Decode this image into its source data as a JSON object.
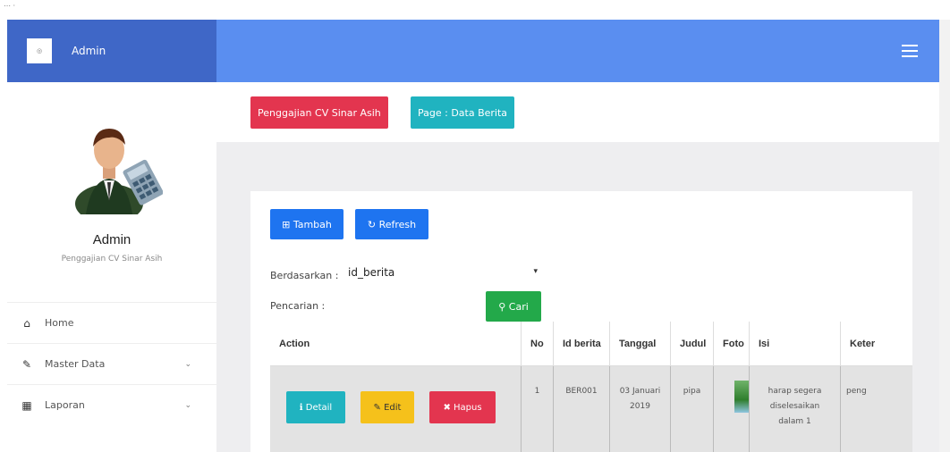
{
  "brand": {
    "name": "Admin"
  },
  "profile": {
    "name": "Admin",
    "subtitle": "Penggajian CV Sinar Asih"
  },
  "sidebar": {
    "items": [
      {
        "icon": "home-icon",
        "label": "Home"
      },
      {
        "icon": "edit-icon",
        "label": "Master Data"
      },
      {
        "icon": "calendar-icon",
        "label": "Laporan"
      }
    ]
  },
  "header": {
    "badge_app": "Penggajian CV Sinar Asih",
    "badge_page": "Page : Data Berita"
  },
  "toolbar": {
    "tambah_label": "Tambah",
    "refresh_label": "Refresh"
  },
  "search": {
    "filter_label": "Berdasarkan :",
    "filter_value": "id_berita",
    "search_label": "Pencarian :",
    "search_value": "",
    "cari_label": "Cari"
  },
  "table": {
    "headers": [
      "Action",
      "No",
      "Id berita",
      "Tanggal",
      "Judul",
      "Foto",
      "Isi",
      "Keter"
    ],
    "rows": [
      {
        "no": "1",
        "id_berita": "BER001",
        "tanggal": "03 Januari 2019",
        "judul": "pipa",
        "isi": "harap segera diselesaikan dalam 1",
        "keterangan": "peng",
        "actions": {
          "detail": "Detail",
          "edit": "Edit",
          "hapus": "Hapus"
        }
      }
    ]
  },
  "colors": {
    "brand_bg": "#3f67c7",
    "navbar_bg": "#5a8ef0",
    "badge_red": "#e3354f",
    "badge_teal": "#20b3c0",
    "btn_blue": "#1e74f0",
    "btn_green": "#23a94a",
    "btn_yellow": "#f5c11b"
  }
}
